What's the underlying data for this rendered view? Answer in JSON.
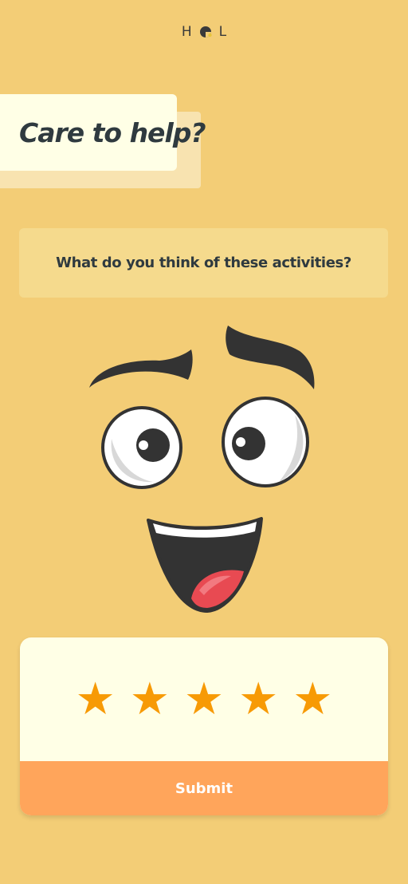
{
  "brand": {
    "letters_left": "H",
    "letters_right": "L",
    "mark_icon": "o-half-dot-icon"
  },
  "header_card": {
    "title": "Care to help?"
  },
  "question": {
    "text": "What do you think of these activities?"
  },
  "illustration": {
    "name": "happy-face-icon"
  },
  "rating": {
    "max": 5,
    "stars": [
      "★",
      "★",
      "★",
      "★",
      "★"
    ],
    "icon": "star-icon"
  },
  "submit": {
    "label": "Submit"
  },
  "colors": {
    "background": "#f3cd76",
    "card": "#ffffe6",
    "question_box": "#f5da8d",
    "star": "#f79a05",
    "submit": "#ffa55b",
    "text_dark": "#2f3a3f"
  }
}
